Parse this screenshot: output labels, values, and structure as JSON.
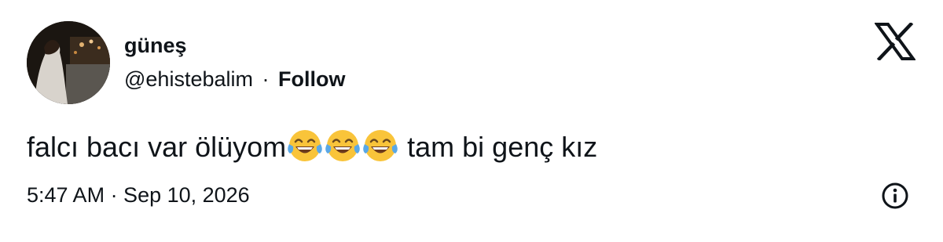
{
  "user": {
    "display_name": "güneş",
    "handle": "@ehistebalim",
    "separator": "·",
    "follow_label": "Follow"
  },
  "tweet": {
    "text_before": "falcı bacı var ölüyom",
    "emojis": [
      "face-with-tears-of-joy-icon",
      "face-with-tears-of-joy-icon",
      "face-with-tears-of-joy-icon"
    ],
    "text_after": " tam bi genç kız",
    "timestamp": "5:47 AM · Sep 10, 2026"
  },
  "icons": {
    "brand": "x-logo-icon",
    "info": "info-icon"
  },
  "colors": {
    "text": "#0f1419",
    "background": "#ffffff",
    "emoji_face": "#f9c43a"
  }
}
